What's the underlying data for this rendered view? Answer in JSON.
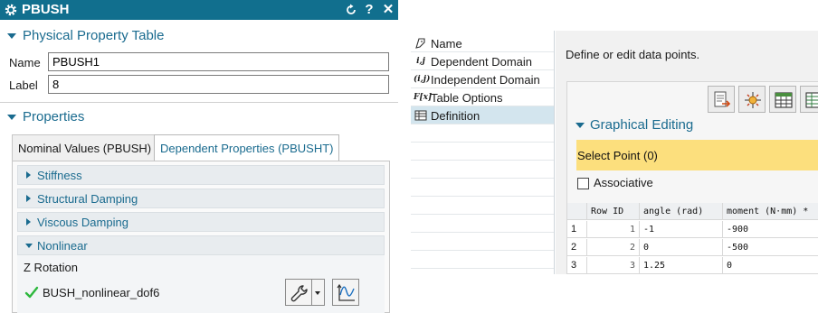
{
  "left_dialog": {
    "title": "PBUSH",
    "titlebar_buttons": [
      "reset",
      "help",
      "close"
    ],
    "help_glyph": "?",
    "close_glyph": "✕",
    "physical_property_table": {
      "heading": "Physical Property Table",
      "name_label": "Name",
      "name_value": "PBUSH1",
      "label_label": "Label",
      "label_value": "8"
    },
    "properties": {
      "heading": "Properties",
      "tabs": [
        {
          "label": "Nominal Values (PBUSH)",
          "active": false
        },
        {
          "label": "Dependent Properties (PBUSHT)",
          "active": true
        }
      ],
      "groups": [
        {
          "label": "Stiffness",
          "expanded": false
        },
        {
          "label": "Structural Damping",
          "expanded": false
        },
        {
          "label": "Viscous Damping",
          "expanded": false
        },
        {
          "label": "Nonlinear",
          "expanded": true
        }
      ],
      "nonlinear": {
        "field_label": "Z Rotation",
        "function_name": "BUSH_nonlinear_dof6",
        "status": "valid"
      }
    }
  },
  "right_dialog": {
    "nav_items": [
      {
        "label": "Name",
        "icon": "name-icon",
        "glyph": "",
        "selected": false
      },
      {
        "label": "Dependent Domain",
        "icon": "dependent-domain-icon",
        "glyph": "i,j",
        "selected": false
      },
      {
        "label": "Independent Domain",
        "icon": "independent-domain-icon",
        "glyph": "(i,j)",
        "selected": false
      },
      {
        "label": "Table Options",
        "icon": "table-options-icon",
        "glyph": "F[x]",
        "selected": false
      },
      {
        "label": "Definition",
        "icon": "definition-icon",
        "glyph": "",
        "selected": true
      }
    ],
    "instruction": "Define or edit data points.",
    "toolbar": [
      "import-points-icon",
      "edit-points-icon",
      "table-view-icon",
      "spreadsheet-icon"
    ],
    "graphical_editing": {
      "heading": "Graphical Editing",
      "select_point_label": "Select Point (0)",
      "associative_label": "Associative",
      "associative_checked": false
    },
    "grid": {
      "columns": [
        "",
        "Row ID",
        "angle (rad)",
        "moment (N·mm) *"
      ],
      "rows": [
        [
          "1",
          "1",
          "-1",
          "-900"
        ],
        [
          "2",
          "2",
          "0",
          "-500"
        ],
        [
          "3",
          "3",
          "1.25",
          "0"
        ]
      ]
    }
  },
  "colors": {
    "titlebar": "#116f8e",
    "accent": "#1a6b8f",
    "selection_highlight": "#fcdf7d",
    "nav_selected": "#d3e5ee",
    "check_green": "#2db83d"
  }
}
